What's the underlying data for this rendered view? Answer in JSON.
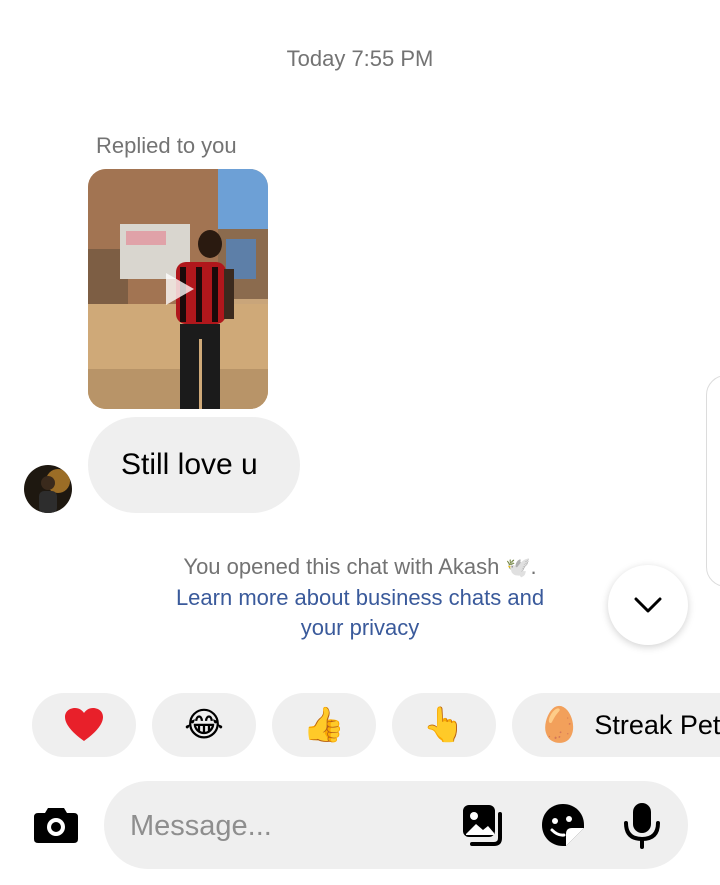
{
  "header": {
    "timestamp": "Today 7:55 PM"
  },
  "reply": {
    "label": "Replied to you",
    "media_type": "video",
    "media_icon": "play-icon"
  },
  "message": {
    "text": "Still love u",
    "avatar_icon": "avatar"
  },
  "notice": {
    "text": "You opened this chat with Akash",
    "emoji": "🕊️",
    "suffix": ".",
    "link_line1": "Learn more about business chats and",
    "link_line2": "your privacy"
  },
  "scroll_button": {
    "icon": "chevron-down-icon"
  },
  "quick_reactions": [
    {
      "emoji": "❤️"
    },
    {
      "emoji": "😂"
    },
    {
      "emoji": "👍"
    },
    {
      "emoji": "👆"
    },
    {
      "emoji": "🥚",
      "label": "Streak Pet"
    }
  ],
  "composer": {
    "placeholder": "Message...",
    "icons": [
      "camera-icon",
      "gallery-icon",
      "sticker-icon",
      "microphone-icon"
    ]
  },
  "colors": {
    "bubble_bg": "#efefef",
    "muted_text": "#737373",
    "link": "#3a5a9b",
    "heart": "#e8202a"
  }
}
